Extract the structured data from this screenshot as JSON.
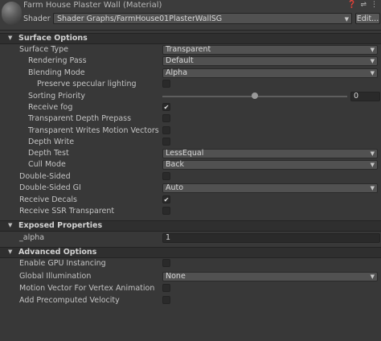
{
  "header": {
    "title": "Farm House Plaster Wall (Material)",
    "help_icon": "question-icon",
    "settings_icon": "sliders-icon",
    "menu_icon": "kebab-icon",
    "shader_label": "Shader",
    "shader_value": "Shader Graphs/FarmHouse01PlasterWallSG",
    "edit_label": "Edit..."
  },
  "surface_options": {
    "title": "Surface Options",
    "surface_type": {
      "label": "Surface Type",
      "value": "Transparent"
    },
    "rendering_pass": {
      "label": "Rendering Pass",
      "value": "Default"
    },
    "blending_mode": {
      "label": "Blending Mode",
      "value": "Alpha"
    },
    "preserve_specular": {
      "label": "Preserve specular lighting",
      "checked": false
    },
    "sorting_priority": {
      "label": "Sorting Priority",
      "value": "0"
    },
    "receive_fog": {
      "label": "Receive fog",
      "checked": true,
      "mark": "✔"
    },
    "depth_prepass": {
      "label": "Transparent Depth Prepass",
      "checked": false
    },
    "motion_vectors": {
      "label": "Transparent Writes Motion Vectors",
      "checked": false
    },
    "depth_write": {
      "label": "Depth Write",
      "checked": false
    },
    "depth_test": {
      "label": "Depth Test",
      "value": "LessEqual"
    },
    "cull_mode": {
      "label": "Cull Mode",
      "value": "Back"
    },
    "double_sided": {
      "label": "Double-Sided",
      "checked": false
    },
    "double_sided_gi": {
      "label": "Double-Sided GI",
      "value": "Auto"
    },
    "receive_decals": {
      "label": "Receive Decals",
      "checked": true,
      "mark": "✔"
    },
    "receive_ssr": {
      "label": "Receive SSR Transparent",
      "checked": false
    }
  },
  "exposed_properties": {
    "title": "Exposed Properties",
    "alpha": {
      "label": "_alpha",
      "value": "1"
    }
  },
  "advanced_options": {
    "title": "Advanced Options",
    "gpu_instancing": {
      "label": "Enable GPU Instancing",
      "checked": false
    },
    "global_illumination": {
      "label": "Global Illumination",
      "value": "None"
    },
    "motion_vector_vertex": {
      "label": "Motion Vector For Vertex Animation",
      "checked": false
    },
    "precomputed_velocity": {
      "label": "Add Precomputed Velocity",
      "checked": false
    }
  },
  "glyphs": {
    "expanded": "▼",
    "dropdown": "▼"
  }
}
